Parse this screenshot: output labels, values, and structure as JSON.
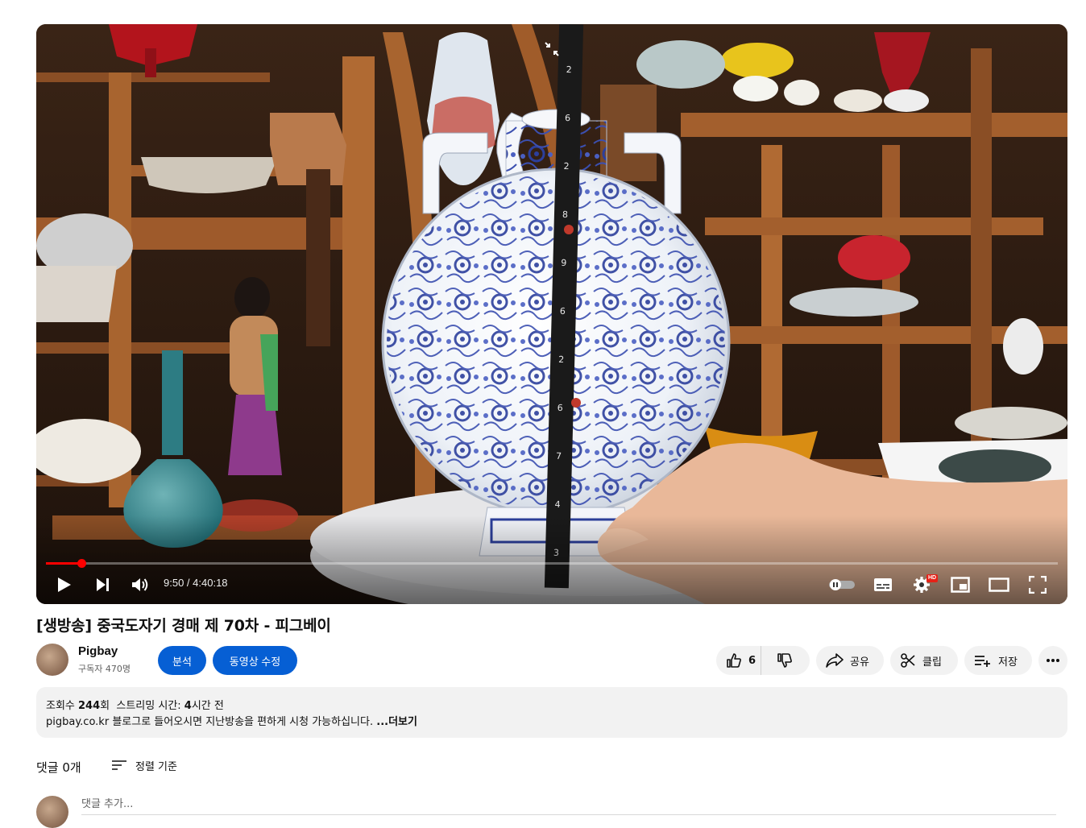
{
  "player": {
    "current_time": "9:50",
    "duration": "4:40:18",
    "time_separator": " / ",
    "progress_fraction": 0.035,
    "quality_badge": "HD",
    "accent_color": "#ff0000",
    "icons": [
      "play-icon",
      "next-icon",
      "volume-icon",
      "autoplay-toggle-icon",
      "subtitles-icon",
      "settings-icon",
      "miniplayer-icon",
      "theater-mode-icon",
      "fullscreen-icon",
      "collapse-icon"
    ]
  },
  "video": {
    "title": "[생방송] 중국도자기 경매 제 70차 - 피그베이"
  },
  "channel": {
    "name": "Pigbay",
    "subscribers": "구독자 470명"
  },
  "buttons": {
    "analytics": "분석",
    "edit_video": "동영상 수정",
    "like_count": "6",
    "share": "공유",
    "clip": "클립",
    "save": "저장"
  },
  "description": {
    "views_label": "조회수 ",
    "views_value": "244",
    "views_suffix": "회  스트리밍 시간: ",
    "stream_hours": "4",
    "stream_suffix": "시간 전",
    "text": "pigbay.co.kr 블로그로 들어오시면 지난방송을 편하게 시청 가능하십니다. ",
    "more": "...더보기"
  },
  "comments": {
    "count_label": "댓글 0개",
    "sort_label": "정렬 기준",
    "placeholder": "댓글 추가..."
  },
  "colors": {
    "primary_blue": "#065fd4",
    "pill_bg": "#f2f2f2",
    "text_secondary": "#606060"
  }
}
